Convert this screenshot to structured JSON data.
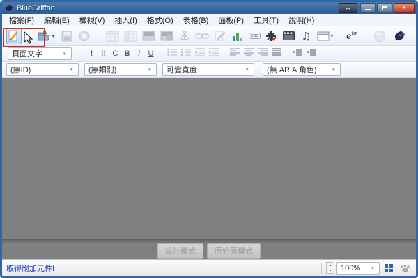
{
  "window": {
    "title": "BlueGriffon"
  },
  "titlebar": {
    "resize_horizontal_glyph": "↔",
    "close_glyph": "×"
  },
  "menu": {
    "items": [
      "檔案(F)",
      "編輯(E)",
      "檢視(V)",
      "插入(I)",
      "格式(O)",
      "表格(B)",
      "面板(P)",
      "工具(T)",
      "說明(H)"
    ]
  },
  "toolbar": {
    "icon_names": [
      "new-document",
      "open-file",
      "save",
      "stop",
      "insert-table",
      "table-properties",
      "insert-image",
      "image-properties",
      "anchor",
      "link",
      "edit-page",
      "chart",
      "css",
      "spellcheck",
      "video",
      "audio",
      "form-frame",
      "math",
      "globe",
      "bluegriffon-logo"
    ],
    "css_label": "css",
    "math_base": "e",
    "math_sup": "iπ"
  },
  "format_toolbar": {
    "style_value": "頁面文字",
    "buttons": [
      "!",
      "!!",
      "C",
      "B",
      "I",
      "U"
    ]
  },
  "attributes_toolbar": {
    "id_value": "(無ID)",
    "class_value": "(無類別)",
    "width_value": "可變寬度",
    "aria_value": "(無 ARIA 角色)"
  },
  "editor": {
    "design_mode_label": "設計模式",
    "source_mode_label": "原始碼模式"
  },
  "statusbar": {
    "addons_link": "取得附加元件!",
    "zoom_value": "100%"
  },
  "icons": {
    "caret_down": "▾",
    "spin_up": "▲",
    "spin_down": "▼",
    "music_note": "♫"
  },
  "colors": {
    "annotation_red": "#df271b",
    "content_gray": "#808080",
    "titlebar_blue": "#2d5b92",
    "link_blue": "#1b35c0"
  }
}
